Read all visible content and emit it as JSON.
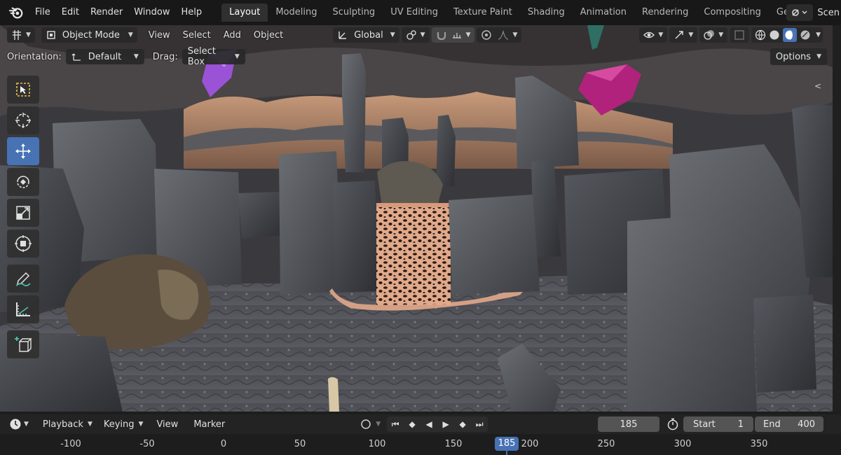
{
  "app": {
    "name": "Blender"
  },
  "menu": [
    "File",
    "Edit",
    "Render",
    "Window",
    "Help"
  ],
  "workspaces": [
    {
      "label": "Layout",
      "active": true
    },
    {
      "label": "Modeling"
    },
    {
      "label": "Sculpting"
    },
    {
      "label": "UV Editing"
    },
    {
      "label": "Texture Paint"
    },
    {
      "label": "Shading"
    },
    {
      "label": "Animation"
    },
    {
      "label": "Rendering"
    },
    {
      "label": "Compositing"
    },
    {
      "label": "Geometry N"
    }
  ],
  "scene": {
    "label": "Scen"
  },
  "viewport_header": {
    "mode": "Object Mode",
    "menus": [
      "View",
      "Select",
      "Add",
      "Object"
    ],
    "transform_orientation": "Global"
  },
  "tool_settings": {
    "orientation_label": "Orientation:",
    "orientation_value": "Default",
    "drag_label": "Drag:",
    "drag_value": "Select Box",
    "options_label": "Options"
  },
  "tools": [
    {
      "name": "select-box-tool",
      "active": false
    },
    {
      "name": "cursor-tool",
      "active": false
    },
    {
      "name": "move-tool",
      "active": true
    },
    {
      "name": "rotate-tool",
      "active": false
    },
    {
      "name": "scale-tool",
      "active": false
    },
    {
      "name": "transform-tool",
      "active": false
    },
    {
      "name": "annotate-tool",
      "active": false
    },
    {
      "name": "measure-tool",
      "active": false
    },
    {
      "name": "add-cube-tool",
      "active": false
    }
  ],
  "timeline": {
    "menus": [
      "Playback",
      "Keying",
      "View",
      "Marker"
    ],
    "current_frame": "185",
    "start_label": "Start",
    "start_value": "1",
    "end_label": "End",
    "end_value": "400",
    "ruler_ticks": [
      "-100",
      "-50",
      "0",
      "50",
      "100",
      "150",
      "200",
      "250",
      "300",
      "350"
    ],
    "playhead_label": "185"
  },
  "colors": {
    "accent": "#4772b3",
    "topbar": "#181818",
    "panel": "#303030"
  }
}
